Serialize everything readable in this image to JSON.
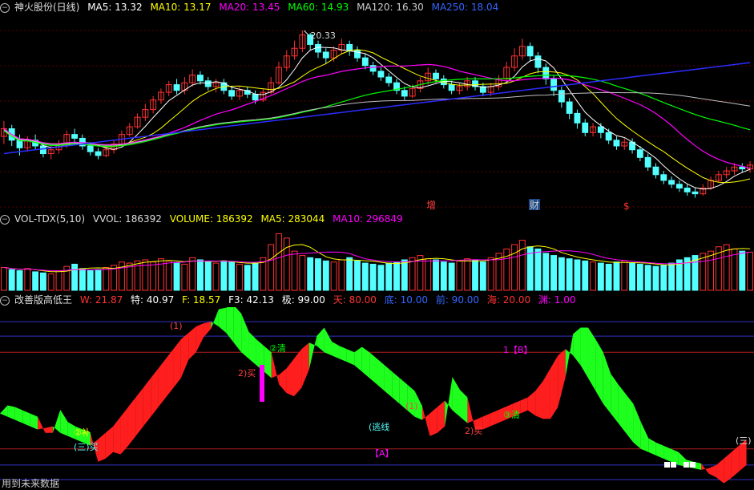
{
  "price_header": {
    "title": "神火股份(日线)",
    "ma5": "MA5: 13.32",
    "ma10": "MA10: 13.17",
    "ma20": "MA20: 13.45",
    "ma60": "MA60: 14.93",
    "ma120": "MA120: 16.30",
    "ma250": "MA250: 18.04"
  },
  "vol_header": {
    "name": "VOL-TDX(5,10)",
    "vvol": "VVOL: 186392",
    "volume": "VOLUME: 186392",
    "ma5": "MA5: 283044",
    "ma10": "MA10: 296849"
  },
  "ind_header": {
    "name": "改善版高低王",
    "w": "W: 21.87",
    "te": "特: 40.97",
    "f": "F: 18.57",
    "f3": "F3: 42.13",
    "ji": "极: 99.00",
    "tian": "天: 80.00",
    "di": "底: 10.00",
    "qian": "前: 90.00",
    "hai": "海: 20.00",
    "yuan": "渊: 1.00"
  },
  "price_annotations": {
    "high_label": "20.33",
    "marker_zeng": "增",
    "marker_cai": "财",
    "marker_s": "$"
  },
  "ind_labels": {
    "l1": "(1)",
    "l2": "②清",
    "l3": "2)买",
    "l4": "②补",
    "l5": "(三)买",
    "l6": "(1)",
    "l7": "2)买",
    "l8": "(逃线",
    "l9": "【A】",
    "l10": "③清",
    "l11": "1【B】",
    "l12": "(三)"
  },
  "footer": "用到未来数据",
  "colors": {
    "up": "#ff3232",
    "down": "#54ffff",
    "ma5": "#ffffff",
    "ma10": "#ffff00",
    "ma20": "#ff00ff",
    "ma60": "#00ff00",
    "ma120": "#c0c0c0",
    "ma250": "#2c2cff",
    "hline_red": "#b41e1e",
    "hline_blue": "#3232c8",
    "fill_red": "#ff1e1e",
    "fill_green": "#1eff1e"
  },
  "chart_data": [
    {
      "type": "candlestick",
      "title": "神火股份(日线)",
      "y_range": [
        11.2,
        21.0
      ],
      "high_marker": 20.33,
      "candles": [
        [
          14.8,
          15.2,
          15.6,
          14.4
        ],
        [
          15.2,
          14.6,
          15.4,
          14.3
        ],
        [
          14.6,
          14.2,
          14.9,
          13.8
        ],
        [
          14.2,
          14.6,
          14.8,
          14.0
        ],
        [
          14.6,
          14.3,
          14.9,
          14.1
        ],
        [
          14.3,
          13.9,
          14.5,
          13.7
        ],
        [
          13.9,
          14.1,
          14.3,
          13.6
        ],
        [
          14.1,
          14.4,
          14.6,
          13.9
        ],
        [
          14.4,
          14.9,
          15.1,
          14.2
        ],
        [
          14.9,
          14.7,
          15.2,
          14.5
        ],
        [
          14.7,
          14.3,
          14.9,
          14.1
        ],
        [
          14.3,
          14.0,
          14.5,
          13.8
        ],
        [
          14.0,
          13.8,
          14.2,
          13.6
        ],
        [
          13.8,
          14.1,
          14.3,
          13.7
        ],
        [
          14.1,
          14.4,
          14.6,
          13.9
        ],
        [
          14.4,
          14.9,
          15.1,
          14.3
        ],
        [
          14.9,
          15.3,
          15.5,
          14.8
        ],
        [
          15.3,
          15.8,
          16.0,
          15.2
        ],
        [
          15.8,
          16.2,
          16.5,
          15.6
        ],
        [
          16.2,
          16.7,
          16.9,
          16.0
        ],
        [
          16.7,
          17.1,
          17.3,
          16.5
        ],
        [
          17.1,
          17.5,
          17.7,
          16.9
        ],
        [
          17.5,
          17.2,
          17.8,
          17.0
        ],
        [
          17.2,
          17.6,
          17.9,
          17.0
        ],
        [
          17.6,
          18.0,
          18.3,
          17.4
        ],
        [
          18.0,
          17.7,
          18.2,
          17.5
        ],
        [
          17.7,
          17.4,
          17.9,
          17.2
        ],
        [
          17.4,
          17.6,
          17.8,
          17.1
        ],
        [
          17.6,
          17.2,
          17.8,
          17.0
        ],
        [
          17.2,
          16.9,
          17.4,
          16.7
        ],
        [
          16.9,
          17.2,
          17.4,
          16.7
        ],
        [
          17.2,
          17.0,
          17.4,
          16.8
        ],
        [
          17.0,
          16.7,
          17.2,
          16.5
        ],
        [
          16.7,
          17.1,
          17.3,
          16.6
        ],
        [
          17.1,
          17.6,
          17.9,
          17.0
        ],
        [
          17.6,
          18.4,
          18.7,
          17.5
        ],
        [
          18.4,
          19.0,
          19.3,
          18.2
        ],
        [
          19.0,
          19.4,
          19.8,
          18.8
        ],
        [
          19.4,
          20.1,
          20.33,
          19.2
        ],
        [
          20.1,
          19.6,
          20.2,
          19.3
        ],
        [
          19.6,
          19.2,
          19.8,
          18.9
        ],
        [
          19.2,
          18.9,
          19.4,
          18.6
        ],
        [
          18.9,
          19.3,
          19.5,
          18.7
        ],
        [
          19.3,
          19.6,
          19.9,
          19.1
        ],
        [
          19.6,
          19.3,
          19.8,
          19.0
        ],
        [
          19.3,
          18.9,
          19.5,
          18.7
        ],
        [
          18.9,
          18.5,
          19.1,
          18.3
        ],
        [
          18.5,
          18.2,
          18.7,
          18.0
        ],
        [
          18.2,
          17.9,
          18.4,
          17.7
        ],
        [
          17.9,
          17.6,
          18.1,
          17.4
        ],
        [
          17.6,
          17.2,
          17.8,
          17.0
        ],
        [
          17.2,
          16.9,
          17.4,
          16.7
        ],
        [
          16.9,
          17.3,
          17.5,
          16.8
        ],
        [
          17.3,
          17.7,
          17.9,
          17.1
        ],
        [
          17.7,
          18.1,
          18.4,
          17.5
        ],
        [
          18.1,
          17.8,
          18.3,
          17.6
        ],
        [
          17.8,
          17.5,
          18.0,
          17.3
        ],
        [
          17.5,
          17.2,
          17.7,
          17.0
        ],
        [
          17.2,
          17.4,
          17.6,
          17.0
        ],
        [
          17.4,
          17.7,
          17.9,
          17.2
        ],
        [
          17.7,
          17.4,
          17.9,
          17.2
        ],
        [
          17.4,
          17.1,
          17.6,
          16.9
        ],
        [
          17.1,
          17.4,
          17.6,
          16.9
        ],
        [
          17.4,
          17.8,
          18.0,
          17.2
        ],
        [
          17.8,
          18.4,
          18.7,
          17.6
        ],
        [
          18.4,
          19.0,
          19.4,
          18.2
        ],
        [
          19.0,
          19.5,
          19.9,
          18.8
        ],
        [
          19.5,
          19.0,
          19.7,
          18.7
        ],
        [
          19.0,
          18.4,
          19.2,
          18.1
        ],
        [
          18.4,
          17.8,
          18.6,
          17.5
        ],
        [
          17.8,
          17.2,
          18.0,
          16.9
        ],
        [
          17.2,
          16.6,
          17.4,
          16.3
        ],
        [
          16.6,
          16.0,
          16.8,
          15.7
        ],
        [
          16.0,
          15.5,
          16.2,
          15.2
        ],
        [
          15.5,
          15.0,
          15.7,
          14.8
        ],
        [
          15.0,
          15.3,
          15.5,
          14.8
        ],
        [
          15.3,
          15.0,
          15.5,
          14.7
        ],
        [
          15.0,
          14.6,
          15.2,
          14.4
        ],
        [
          14.6,
          14.3,
          14.8,
          14.1
        ],
        [
          14.3,
          14.5,
          14.7,
          14.1
        ],
        [
          14.5,
          14.1,
          14.7,
          13.9
        ],
        [
          14.1,
          13.7,
          14.3,
          13.5
        ],
        [
          13.7,
          13.2,
          13.9,
          13.0
        ],
        [
          13.2,
          12.8,
          13.4,
          12.6
        ],
        [
          12.8,
          12.5,
          13.0,
          12.3
        ],
        [
          12.5,
          12.3,
          12.7,
          12.1
        ],
        [
          12.3,
          12.1,
          12.5,
          11.9
        ],
        [
          12.1,
          11.9,
          12.3,
          11.7
        ],
        [
          11.9,
          11.8,
          12.1,
          11.6
        ],
        [
          11.8,
          12.1,
          12.3,
          11.7
        ],
        [
          12.1,
          12.5,
          12.7,
          12.0
        ],
        [
          12.5,
          12.8,
          13.0,
          12.4
        ],
        [
          12.8,
          13.0,
          13.2,
          12.6
        ],
        [
          13.0,
          13.2,
          13.4,
          12.8
        ],
        [
          13.2,
          13.1,
          13.4,
          12.9
        ],
        [
          13.1,
          13.3,
          13.5,
          12.9
        ]
      ]
    },
    {
      "type": "bar",
      "title": "VOL-TDX(5,10)",
      "ylim": [
        0,
        560000
      ],
      "values": [
        210000,
        190000,
        180000,
        200000,
        170000,
        160000,
        150000,
        180000,
        220000,
        240000,
        200000,
        180000,
        190000,
        210000,
        230000,
        260000,
        250000,
        270000,
        280000,
        260000,
        290000,
        270000,
        250000,
        240000,
        300000,
        280000,
        260000,
        250000,
        270000,
        260000,
        240000,
        230000,
        250000,
        300000,
        420000,
        520000,
        480000,
        360000,
        320000,
        300000,
        290000,
        270000,
        260000,
        280000,
        300000,
        270000,
        250000,
        240000,
        230000,
        250000,
        260000,
        280000,
        300000,
        320000,
        290000,
        280000,
        260000,
        250000,
        270000,
        290000,
        280000,
        260000,
        300000,
        340000,
        380000,
        420000,
        460000,
        400000,
        380000,
        340000,
        320000,
        300000,
        290000,
        280000,
        270000,
        260000,
        250000,
        240000,
        260000,
        270000,
        250000,
        240000,
        230000,
        220000,
        230000,
        250000,
        280000,
        300000,
        320000,
        340000,
        360000,
        400000,
        420000,
        380000,
        360000,
        350000
      ]
    },
    {
      "type": "area",
      "title": "改善版高低王",
      "ylim": [
        -5,
        108
      ],
      "levels": [
        1,
        10,
        20,
        80,
        90,
        99
      ],
      "w": [
        42,
        40,
        38,
        36,
        34,
        32,
        33,
        34,
        30,
        28,
        26,
        24,
        22,
        26,
        30,
        34,
        40,
        46,
        52,
        58,
        64,
        70,
        76,
        82,
        88,
        92,
        96,
        98,
        99,
        96,
        92,
        86,
        80,
        76,
        72,
        68,
        64,
        66,
        70,
        76,
        82,
        86,
        84,
        80,
        78,
        76,
        74,
        72,
        68,
        64,
        60,
        56,
        52,
        48,
        44,
        40,
        38,
        42,
        46,
        50,
        44,
        40,
        36,
        38,
        40,
        42,
        44,
        46,
        48,
        50,
        52,
        56,
        62,
        70,
        78,
        82,
        78,
        72,
        64,
        56,
        48,
        42,
        36,
        30,
        24,
        20,
        18,
        16,
        14,
        12,
        10,
        9,
        8,
        7,
        8,
        10,
        14,
        18,
        22,
        26
      ]
    }
  ]
}
